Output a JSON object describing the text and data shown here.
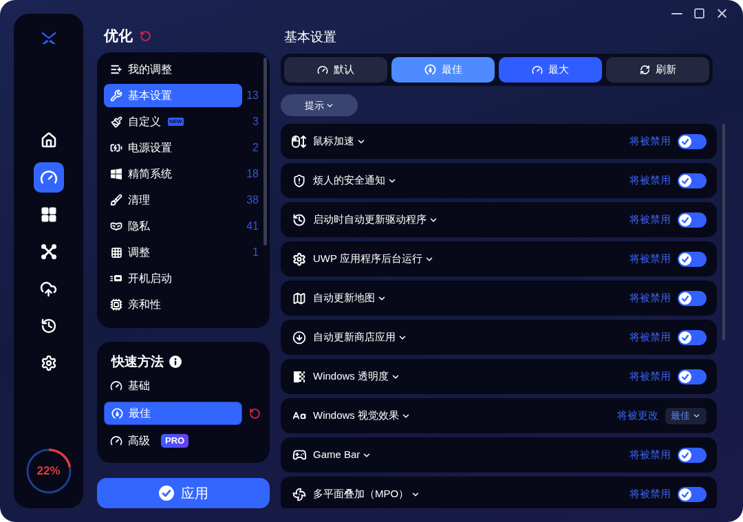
{
  "sidebar": {
    "nav": [
      {
        "selected": false
      },
      {
        "selected": true
      },
      {
        "selected": false
      },
      {
        "selected": false
      },
      {
        "selected": false
      },
      {
        "selected": false
      },
      {
        "selected": false
      }
    ]
  },
  "usage": {
    "level": 0.22,
    "reading": "22%"
  },
  "optimize": {
    "title": "优化",
    "categories": [
      {
        "label": "我的调整",
        "selected": false
      },
      {
        "label": "基本设置",
        "count": "13",
        "selected": true
      },
      {
        "label": "自定义",
        "badge": "NEW",
        "count": "3",
        "selected": false
      },
      {
        "label": "电源设置",
        "count": "2",
        "selected": false
      },
      {
        "label": "精简系统",
        "count": "18",
        "selected": false
      },
      {
        "label": "清理",
        "count": "38",
        "selected": false
      },
      {
        "label": "隐私",
        "count": "41",
        "selected": false
      },
      {
        "label": "调整",
        "count": "1",
        "selected": false
      },
      {
        "label": "开机启动",
        "selected": false
      },
      {
        "label": "亲和性",
        "selected": false
      }
    ]
  },
  "quick_methods": {
    "title": "快速方法",
    "items": [
      {
        "label": "基础",
        "selected": false
      },
      {
        "label": "最佳",
        "selected": true
      },
      {
        "label": "高级",
        "badge": "PRO",
        "selected": false
      }
    ]
  },
  "apply_button": "应用",
  "main": {
    "title": "基本设置",
    "presets": [
      {
        "label": "默认",
        "selected": false,
        "highlighted": false
      },
      {
        "label": "最佳",
        "selected": true,
        "highlighted": false
      },
      {
        "label": "最大",
        "selected": false,
        "highlighted": true
      },
      {
        "label": "刷新",
        "selected": false,
        "highlighted": false
      }
    ],
    "hint_button": "提示",
    "settings": [
      {
        "label": "鼠标加速",
        "kind": "toggle",
        "status": "将被禁用",
        "checked": true
      },
      {
        "label": "烦人的安全通知",
        "kind": "toggle",
        "status": "将被禁用",
        "checked": true
      },
      {
        "label": "启动时自动更新驱动程序",
        "kind": "toggle",
        "status": "将被禁用",
        "checked": true
      },
      {
        "label": "UWP 应用程序后台运行",
        "kind": "toggle",
        "status": "将被禁用",
        "checked": true
      },
      {
        "label": "自动更新地图",
        "kind": "toggle",
        "status": "将被禁用",
        "checked": true
      },
      {
        "label": "自动更新商店应用",
        "kind": "toggle",
        "status": "将被禁用",
        "checked": true
      },
      {
        "label": "Windows 透明度",
        "kind": "toggle",
        "status": "将被禁用",
        "checked": true
      },
      {
        "label": "Windows 视觉效果",
        "kind": "select",
        "status": "将被更改",
        "value": "最佳"
      },
      {
        "label": "Game Bar",
        "kind": "toggle",
        "status": "将被禁用",
        "checked": true
      },
      {
        "label": "多平面叠加（MPO）",
        "kind": "toggle",
        "status": "将被禁用",
        "checked": true
      }
    ]
  }
}
